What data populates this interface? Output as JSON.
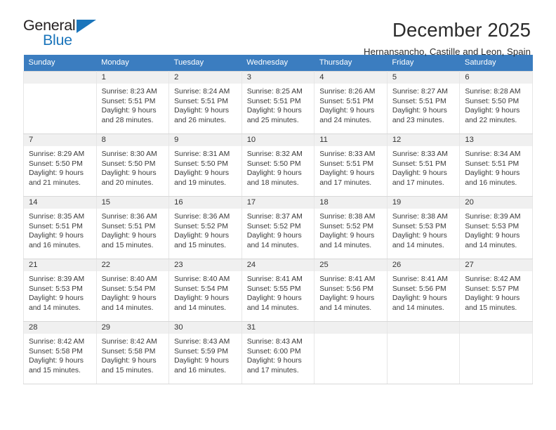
{
  "logo": {
    "text_top": "General",
    "text_bottom": "Blue",
    "triangle_color": "#1b75bb"
  },
  "header": {
    "month_title": "December 2025",
    "location": "Hernansancho, Castille and Leon, Spain"
  },
  "theme": {
    "header_row_bg": "#3b7dc0",
    "header_row_text": "#ffffff",
    "daynum_bg": "#f0f0f0",
    "cell_border": "#d8d8d8"
  },
  "calendar": {
    "weekdays": [
      "Sunday",
      "Monday",
      "Tuesday",
      "Wednesday",
      "Thursday",
      "Friday",
      "Saturday"
    ],
    "weeks": [
      [
        {
          "day": "",
          "sunrise": "",
          "sunset": "",
          "daylight_line1": "",
          "daylight_line2": ""
        },
        {
          "day": "1",
          "sunrise": "Sunrise: 8:23 AM",
          "sunset": "Sunset: 5:51 PM",
          "daylight_line1": "Daylight: 9 hours",
          "daylight_line2": "and 28 minutes."
        },
        {
          "day": "2",
          "sunrise": "Sunrise: 8:24 AM",
          "sunset": "Sunset: 5:51 PM",
          "daylight_line1": "Daylight: 9 hours",
          "daylight_line2": "and 26 minutes."
        },
        {
          "day": "3",
          "sunrise": "Sunrise: 8:25 AM",
          "sunset": "Sunset: 5:51 PM",
          "daylight_line1": "Daylight: 9 hours",
          "daylight_line2": "and 25 minutes."
        },
        {
          "day": "4",
          "sunrise": "Sunrise: 8:26 AM",
          "sunset": "Sunset: 5:51 PM",
          "daylight_line1": "Daylight: 9 hours",
          "daylight_line2": "and 24 minutes."
        },
        {
          "day": "5",
          "sunrise": "Sunrise: 8:27 AM",
          "sunset": "Sunset: 5:51 PM",
          "daylight_line1": "Daylight: 9 hours",
          "daylight_line2": "and 23 minutes."
        },
        {
          "day": "6",
          "sunrise": "Sunrise: 8:28 AM",
          "sunset": "Sunset: 5:50 PM",
          "daylight_line1": "Daylight: 9 hours",
          "daylight_line2": "and 22 minutes."
        }
      ],
      [
        {
          "day": "7",
          "sunrise": "Sunrise: 8:29 AM",
          "sunset": "Sunset: 5:50 PM",
          "daylight_line1": "Daylight: 9 hours",
          "daylight_line2": "and 21 minutes."
        },
        {
          "day": "8",
          "sunrise": "Sunrise: 8:30 AM",
          "sunset": "Sunset: 5:50 PM",
          "daylight_line1": "Daylight: 9 hours",
          "daylight_line2": "and 20 minutes."
        },
        {
          "day": "9",
          "sunrise": "Sunrise: 8:31 AM",
          "sunset": "Sunset: 5:50 PM",
          "daylight_line1": "Daylight: 9 hours",
          "daylight_line2": "and 19 minutes."
        },
        {
          "day": "10",
          "sunrise": "Sunrise: 8:32 AM",
          "sunset": "Sunset: 5:50 PM",
          "daylight_line1": "Daylight: 9 hours",
          "daylight_line2": "and 18 minutes."
        },
        {
          "day": "11",
          "sunrise": "Sunrise: 8:33 AM",
          "sunset": "Sunset: 5:51 PM",
          "daylight_line1": "Daylight: 9 hours",
          "daylight_line2": "and 17 minutes."
        },
        {
          "day": "12",
          "sunrise": "Sunrise: 8:33 AM",
          "sunset": "Sunset: 5:51 PM",
          "daylight_line1": "Daylight: 9 hours",
          "daylight_line2": "and 17 minutes."
        },
        {
          "day": "13",
          "sunrise": "Sunrise: 8:34 AM",
          "sunset": "Sunset: 5:51 PM",
          "daylight_line1": "Daylight: 9 hours",
          "daylight_line2": "and 16 minutes."
        }
      ],
      [
        {
          "day": "14",
          "sunrise": "Sunrise: 8:35 AM",
          "sunset": "Sunset: 5:51 PM",
          "daylight_line1": "Daylight: 9 hours",
          "daylight_line2": "and 16 minutes."
        },
        {
          "day": "15",
          "sunrise": "Sunrise: 8:36 AM",
          "sunset": "Sunset: 5:51 PM",
          "daylight_line1": "Daylight: 9 hours",
          "daylight_line2": "and 15 minutes."
        },
        {
          "day": "16",
          "sunrise": "Sunrise: 8:36 AM",
          "sunset": "Sunset: 5:52 PM",
          "daylight_line1": "Daylight: 9 hours",
          "daylight_line2": "and 15 minutes."
        },
        {
          "day": "17",
          "sunrise": "Sunrise: 8:37 AM",
          "sunset": "Sunset: 5:52 PM",
          "daylight_line1": "Daylight: 9 hours",
          "daylight_line2": "and 14 minutes."
        },
        {
          "day": "18",
          "sunrise": "Sunrise: 8:38 AM",
          "sunset": "Sunset: 5:52 PM",
          "daylight_line1": "Daylight: 9 hours",
          "daylight_line2": "and 14 minutes."
        },
        {
          "day": "19",
          "sunrise": "Sunrise: 8:38 AM",
          "sunset": "Sunset: 5:53 PM",
          "daylight_line1": "Daylight: 9 hours",
          "daylight_line2": "and 14 minutes."
        },
        {
          "day": "20",
          "sunrise": "Sunrise: 8:39 AM",
          "sunset": "Sunset: 5:53 PM",
          "daylight_line1": "Daylight: 9 hours",
          "daylight_line2": "and 14 minutes."
        }
      ],
      [
        {
          "day": "21",
          "sunrise": "Sunrise: 8:39 AM",
          "sunset": "Sunset: 5:53 PM",
          "daylight_line1": "Daylight: 9 hours",
          "daylight_line2": "and 14 minutes."
        },
        {
          "day": "22",
          "sunrise": "Sunrise: 8:40 AM",
          "sunset": "Sunset: 5:54 PM",
          "daylight_line1": "Daylight: 9 hours",
          "daylight_line2": "and 14 minutes."
        },
        {
          "day": "23",
          "sunrise": "Sunrise: 8:40 AM",
          "sunset": "Sunset: 5:54 PM",
          "daylight_line1": "Daylight: 9 hours",
          "daylight_line2": "and 14 minutes."
        },
        {
          "day": "24",
          "sunrise": "Sunrise: 8:41 AM",
          "sunset": "Sunset: 5:55 PM",
          "daylight_line1": "Daylight: 9 hours",
          "daylight_line2": "and 14 minutes."
        },
        {
          "day": "25",
          "sunrise": "Sunrise: 8:41 AM",
          "sunset": "Sunset: 5:56 PM",
          "daylight_line1": "Daylight: 9 hours",
          "daylight_line2": "and 14 minutes."
        },
        {
          "day": "26",
          "sunrise": "Sunrise: 8:41 AM",
          "sunset": "Sunset: 5:56 PM",
          "daylight_line1": "Daylight: 9 hours",
          "daylight_line2": "and 14 minutes."
        },
        {
          "day": "27",
          "sunrise": "Sunrise: 8:42 AM",
          "sunset": "Sunset: 5:57 PM",
          "daylight_line1": "Daylight: 9 hours",
          "daylight_line2": "and 15 minutes."
        }
      ],
      [
        {
          "day": "28",
          "sunrise": "Sunrise: 8:42 AM",
          "sunset": "Sunset: 5:58 PM",
          "daylight_line1": "Daylight: 9 hours",
          "daylight_line2": "and 15 minutes."
        },
        {
          "day": "29",
          "sunrise": "Sunrise: 8:42 AM",
          "sunset": "Sunset: 5:58 PM",
          "daylight_line1": "Daylight: 9 hours",
          "daylight_line2": "and 15 minutes."
        },
        {
          "day": "30",
          "sunrise": "Sunrise: 8:43 AM",
          "sunset": "Sunset: 5:59 PM",
          "daylight_line1": "Daylight: 9 hours",
          "daylight_line2": "and 16 minutes."
        },
        {
          "day": "31",
          "sunrise": "Sunrise: 8:43 AM",
          "sunset": "Sunset: 6:00 PM",
          "daylight_line1": "Daylight: 9 hours",
          "daylight_line2": "and 17 minutes."
        },
        {
          "day": "",
          "sunrise": "",
          "sunset": "",
          "daylight_line1": "",
          "daylight_line2": ""
        },
        {
          "day": "",
          "sunrise": "",
          "sunset": "",
          "daylight_line1": "",
          "daylight_line2": ""
        },
        {
          "day": "",
          "sunrise": "",
          "sunset": "",
          "daylight_line1": "",
          "daylight_line2": ""
        }
      ]
    ]
  }
}
